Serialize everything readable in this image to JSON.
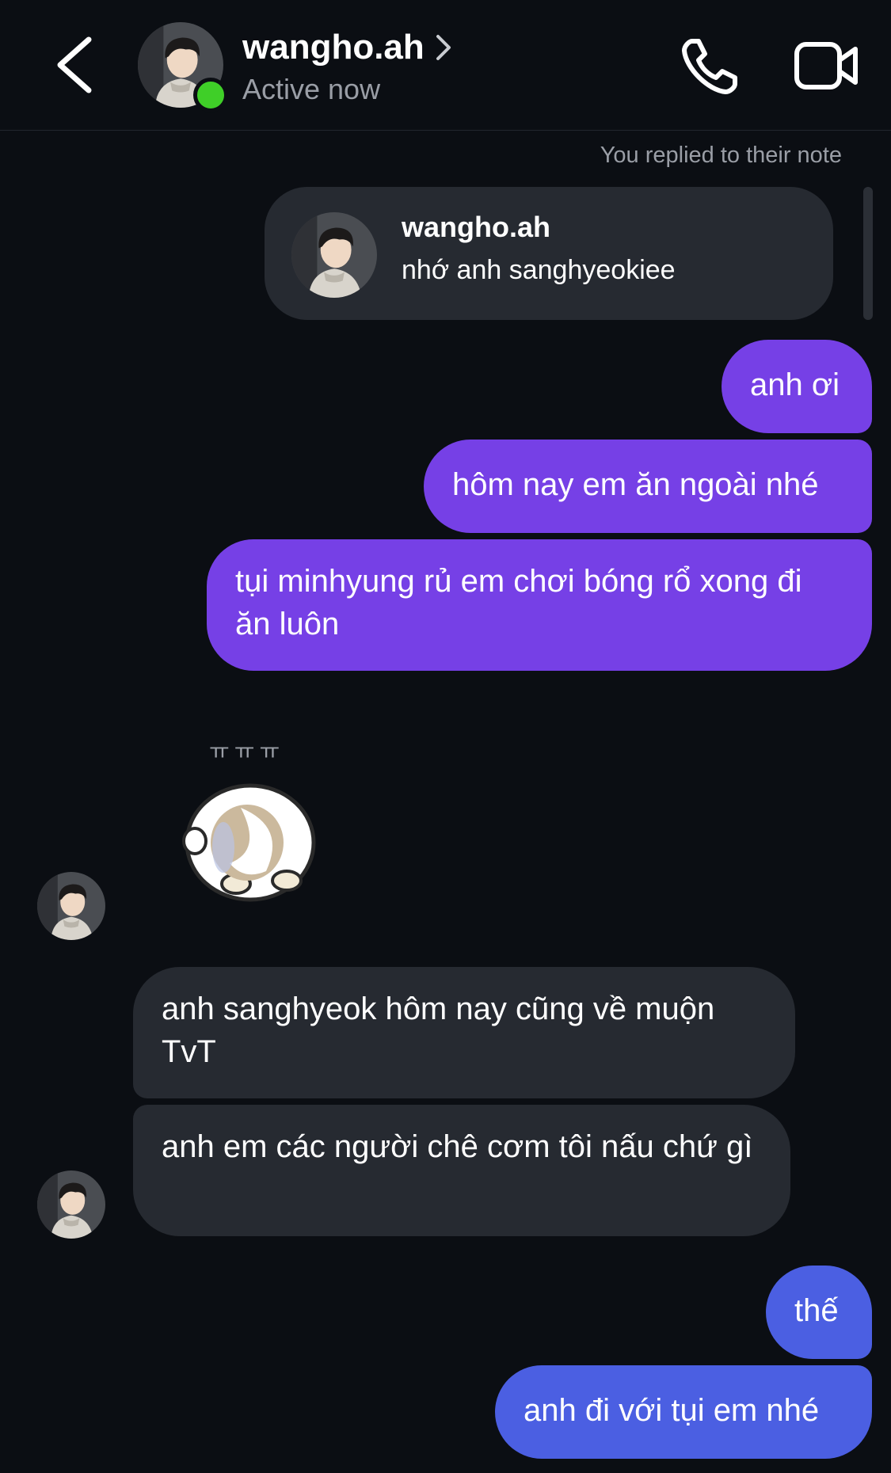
{
  "header": {
    "contact_name": "wangho.ah",
    "status": "Active now",
    "icons": {
      "back": "chevron-left-icon",
      "profile": "chevron-right-icon",
      "call": "phone-icon",
      "video": "video-camera-icon"
    },
    "online_color": "#3fcf28"
  },
  "note": {
    "context_label": "You replied to their note",
    "author": "wangho.ah",
    "text": "nhớ anh sanghyeokiee"
  },
  "messages": [
    {
      "from": "me",
      "text": "anh ơi"
    },
    {
      "from": "me",
      "text": "hôm nay em ăn ngoài nhé"
    },
    {
      "from": "me",
      "text": "tụi minhyung rủ em chơi bóng rổ xong đi ăn luôn"
    },
    {
      "from": "them",
      "type": "sticker",
      "caption": "ㅠㅠㅠ"
    },
    {
      "from": "them",
      "text": "anh sanghyeok hôm nay cũng về muộn TvT"
    },
    {
      "from": "them",
      "text": "anh em các người chê cơm tôi nấu chứ gì"
    },
    {
      "from": "me",
      "text": "thế"
    },
    {
      "from": "me",
      "text": "anh đi với tụi em nhé"
    }
  ],
  "colors": {
    "background": "#0b0e13",
    "sent_purple": "#7640e6",
    "sent_blue": "#4b5fe2",
    "received": "#262a31",
    "secondary_text": "#9a9ea6"
  }
}
